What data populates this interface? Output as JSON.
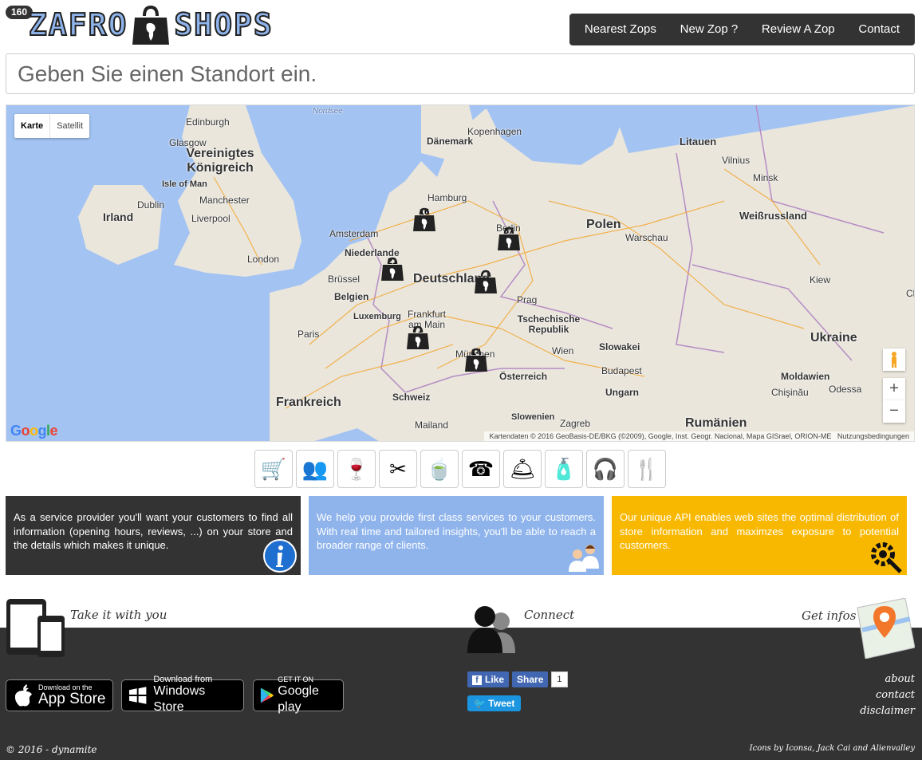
{
  "header": {
    "badge": "160",
    "logo_left": "ZAFRO",
    "logo_right": "SHOPS",
    "nav": [
      "Nearest Zops",
      "New Zop ?",
      "Review A Zop",
      "Contact"
    ]
  },
  "search": {
    "placeholder": "Geben Sie einen Standort ein."
  },
  "map": {
    "type_buttons": [
      "Karte",
      "Satellit"
    ],
    "labels": {
      "nordsee": "Nordsee",
      "edinburgh": "Edinburgh",
      "glasgow": "Glasgow",
      "uk": "Vereinigtes Königreich",
      "isle_of_man": "Isle of Man",
      "manchester": "Manchester",
      "liverpool": "Liverpool",
      "dublin": "Dublin",
      "irland": "Irland",
      "london": "London",
      "amsterdam": "Amsterdam",
      "niederlande": "Niederlande",
      "bruessel": "Brüssel",
      "belgien": "Belgien",
      "luxemburg": "Luxemburg",
      "paris": "Paris",
      "frankreich": "Frankreich",
      "daenemark": "Dänemark",
      "kopenhagen": "Kopenhagen",
      "hamburg": "Hamburg",
      "berlin": "Berlin",
      "deutschland": "Deutschland",
      "frankfurt": "Frankfurt am Main",
      "muenchen": "München",
      "schweiz": "Schweiz",
      "mailand": "Mailand",
      "prag": "Prag",
      "tschechische": "Tschechische Republik",
      "wien": "Wien",
      "oesterreich": "Österreich",
      "slowakei": "Slowakei",
      "budapest": "Budapest",
      "ungarn": "Ungarn",
      "slowenien": "Slowenien",
      "zagreb": "Zagreb",
      "polen": "Polen",
      "warschau": "Warschau",
      "litauen": "Litauen",
      "vilnius": "Vilnius",
      "minsk": "Minsk",
      "weissrussland": "Weißrussland",
      "kiew": "Kiew",
      "ukraine": "Ukraine",
      "moldawien": "Moldawien",
      "chisinau": "Chişinău",
      "odessa": "Odessa",
      "rumaenien": "Rumänien",
      "ch": "Ch"
    },
    "markers": [
      {
        "count": "16"
      },
      {
        "count": "37"
      },
      {
        "count": "21"
      },
      {
        "count": ""
      },
      {
        "count": "71"
      },
      {
        "count": "14"
      }
    ],
    "google": "Google",
    "attribution": "Kartendaten © 2016 GeoBasis-DE/BKG (©2009), Google, Inst. Geogr. Nacional, Mapa GISrael, ORION-ME",
    "terms": "Nutzungsbedingungen",
    "zoom_in": "+",
    "zoom_out": "−"
  },
  "categories": [
    "shopping-cart",
    "people",
    "wine-glass",
    "scissors",
    "tea-cup",
    "telephone",
    "waiter",
    "cosmetics",
    "dj",
    "cutlery"
  ],
  "boxes": [
    {
      "text": "As a service provider you'll want your customers to find all information (opening hours, reviews, ...) on your store and the details which makes it unique.",
      "color": "#333333"
    },
    {
      "text": "We help you provide first class services to your customers. With real time and tailored insights, you'll be able to reach a broader range of clients.",
      "color": "#8fb4ec"
    },
    {
      "text": "Our unique API enables web sites the optimal distribution of store information and maximzes exposure to potential customers.",
      "color": "#f9b800"
    }
  ],
  "footer": {
    "take": "Take it with you",
    "connect": "Connect",
    "infos": "Get infos",
    "appstore_small": "Download on the",
    "appstore_large": "App Store",
    "windows_small": "Download from",
    "windows_large": "Windows Store",
    "google_small": "GET IT ON",
    "google_large": "Google play",
    "fb_like": "Like",
    "fb_share": "Share",
    "fb_count": "1",
    "tweet": "Tweet",
    "links": [
      "about",
      "contact",
      "disclaimer"
    ],
    "copyright": "© 2016 - dynamite",
    "credits": "Icons by Iconsa, Jack Cai and Alienvalley"
  }
}
